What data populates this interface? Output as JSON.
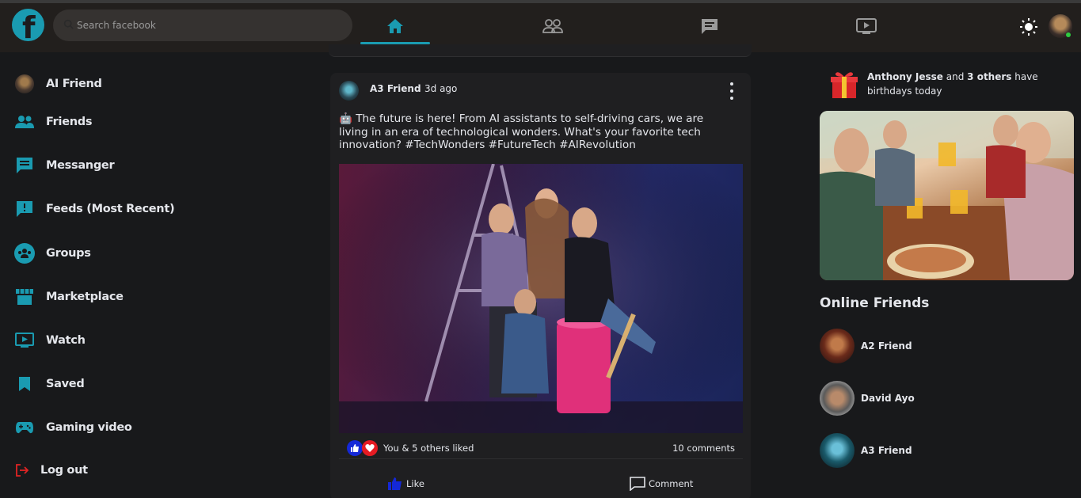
{
  "topbar": {
    "search_placeholder": "Search facebook",
    "logo_letter": "f",
    "nav_icons": [
      "home-icon",
      "friends-icon",
      "messages-icon",
      "watch-icon"
    ],
    "theme_icon": "sun-icon"
  },
  "sidebar": {
    "items": [
      {
        "label": "AI Friend",
        "icon": "avatar"
      },
      {
        "label": "Friends",
        "icon": "friends-icon"
      },
      {
        "label": "Messanger",
        "icon": "message-icon"
      },
      {
        "label": "Feeds (Most Recent)",
        "icon": "feed-icon"
      },
      {
        "label": "Groups",
        "icon": "groups-icon"
      },
      {
        "label": "Marketplace",
        "icon": "store-icon"
      },
      {
        "label": "Watch",
        "icon": "tv-icon"
      },
      {
        "label": "Saved",
        "icon": "bookmark-icon"
      },
      {
        "label": "Gaming video",
        "icon": "gamepad-icon"
      },
      {
        "label": "Log out",
        "icon": "logout-icon"
      }
    ]
  },
  "post": {
    "author": "A3 Friend",
    "time": "3d ago",
    "text": "🤖 The future is here! From AI assistants to self-driving cars, we are living in an era of technological wonders. What's your favorite tech innovation? #TechWonders #FutureTech #AIRevolution",
    "liked_text": "You & 5 others liked",
    "comments": "10 comments",
    "like_label": "Like",
    "comment_label": "Comment"
  },
  "right": {
    "birthday_name": "Anthony Jesse",
    "birthday_and": "and",
    "birthday_others": "3 others",
    "birthday_tail": "have birthdays today",
    "online_title": "Online Friends",
    "friends": [
      "A2 Friend",
      "David Ayo",
      "A3 Friend"
    ]
  },
  "colors": {
    "accent": "#1a9bb1",
    "background": "#18191b",
    "topbar": "#221f1d",
    "card": "#1f1f21",
    "logout_red": "#e02424"
  }
}
